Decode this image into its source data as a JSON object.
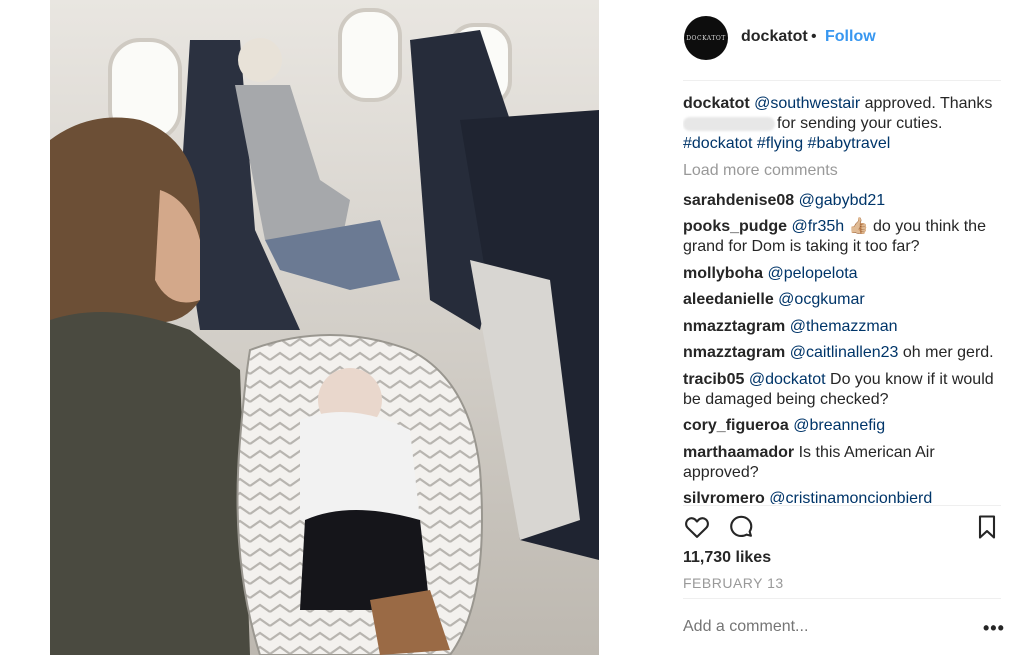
{
  "post": {
    "author": "dockatot",
    "avatar_text": "DOCKATOT",
    "separator": "•",
    "follow_label": "Follow",
    "caption": {
      "user": "dockatot",
      "mention": "@southwestair",
      "text1": " approved. Thanks",
      "text2": "for sending your cuties.",
      "tags": [
        "#dockatot",
        "#flying",
        "#babytravel"
      ]
    },
    "load_more": "Load more comments",
    "comments": [
      {
        "user": "sarahdenise08",
        "mention": "@gabybd21",
        "text": ""
      },
      {
        "user": "pooks_pudge",
        "mention": "@fr35h",
        "emoji": "👍🏼",
        "text": " do you think the grand for Dom is taking it too far?"
      },
      {
        "user": "mollyboha",
        "mention": "@pelopelota",
        "text": ""
      },
      {
        "user": "aleedanielle",
        "mention": "@ocgkumar",
        "text": ""
      },
      {
        "user": "nmazztagram",
        "mention": "@themazzman",
        "text": ""
      },
      {
        "user": "nmazztagram",
        "mention": "@caitlinallen23",
        "text": " oh mer gerd."
      },
      {
        "user": "tracib05",
        "mention": "@dockatot",
        "text": " Do you know if it would be damaged being checked?"
      },
      {
        "user": "cory_figueroa",
        "mention": "@breannefig",
        "text": ""
      },
      {
        "user": "marthaamador",
        "mention": "",
        "text": "Is this American Air approved?"
      },
      {
        "user": "silvromero",
        "mention": "@cristinamoncionbierd",
        "text": ""
      }
    ],
    "likes": "11,730 likes",
    "date": "FEBRUARY 13",
    "add_comment_placeholder": "Add a comment...",
    "more_options": "•••"
  },
  "icons": {
    "like": "heart-icon",
    "comment": "comment-bubble-icon",
    "save": "bookmark-icon",
    "more": "more-options-icon"
  },
  "colors": {
    "link": "#003569",
    "follow": "#3897f0",
    "muted": "#999999",
    "text": "#262626"
  }
}
